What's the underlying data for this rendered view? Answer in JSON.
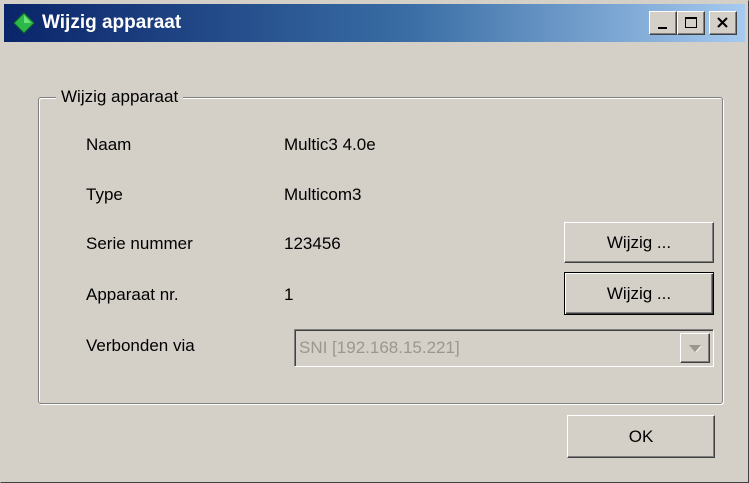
{
  "window": {
    "title": "Wijzig apparaat"
  },
  "group": {
    "legend": "Wijzig apparaat"
  },
  "fields": {
    "naam": {
      "label": "Naam",
      "value": "Multic3 4.0e"
    },
    "type": {
      "label": "Type",
      "value": "Multicom3"
    },
    "serie": {
      "label": "Serie nummer",
      "value": "123456",
      "button": "Wijzig ..."
    },
    "apparaat": {
      "label": "Apparaat nr.",
      "value": "1",
      "button": "Wijzig ..."
    },
    "verbonden": {
      "label": "Verbonden via",
      "selected": "SNI [192.168.15.221]",
      "enabled": false
    }
  },
  "buttons": {
    "ok": "OK"
  },
  "icons": {
    "app": "green-diamond-icon",
    "minimize": "minimize-icon",
    "maximize": "maximize-icon",
    "close": "close-icon",
    "dropdown": "chevron-down-icon"
  },
  "colors": {
    "title_gradient_start": "#0a246a",
    "title_gradient_end": "#a6caf0",
    "face": "#d4d0c8",
    "disabled_text": "#9a978f",
    "app_icon": "#2db84a"
  }
}
